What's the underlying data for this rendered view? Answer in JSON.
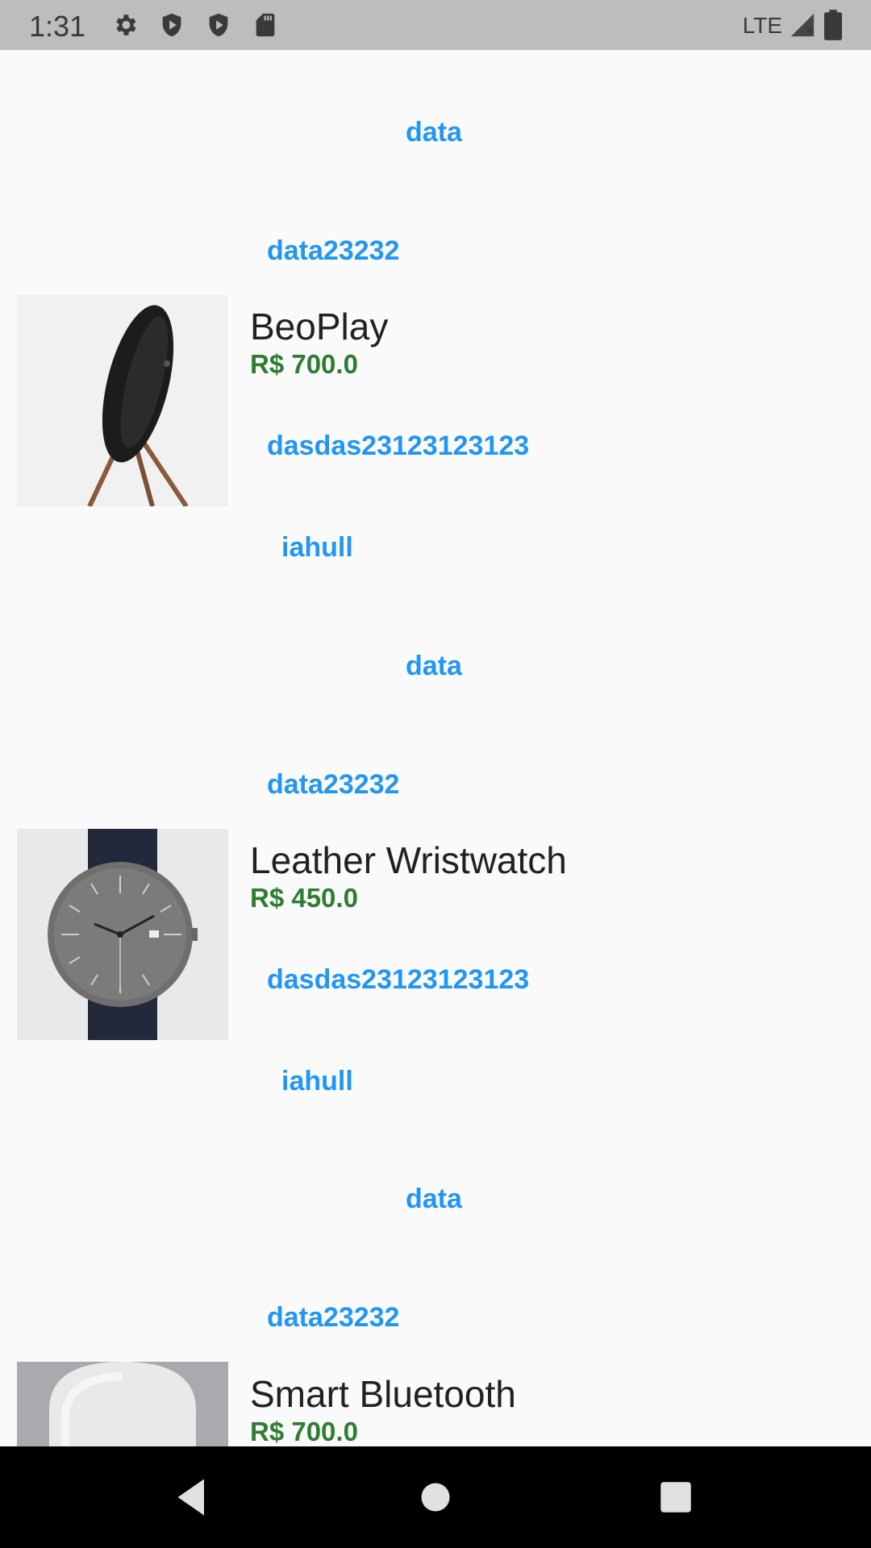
{
  "status_bar": {
    "time": "1:31",
    "network": "LTE",
    "icons": [
      "settings-icon",
      "shield-icon",
      "play-shield-icon",
      "sd-card-icon",
      "signal-icon",
      "battery-icon"
    ]
  },
  "products": [
    {
      "links_above": [
        "data",
        "data23232"
      ],
      "name": "BeoPlay",
      "price": "R$ 700.0",
      "links_below": [
        "dasdas23123123123",
        "iahull"
      ],
      "image": "speaker-on-tripod"
    },
    {
      "links_above": [
        "data",
        "data23232"
      ],
      "name": "Leather Wristwatch",
      "price": "R$ 450.0",
      "links_below": [
        "dasdas23123123123",
        "iahull"
      ],
      "image": "grey-wristwatch"
    },
    {
      "links_above": [
        "data",
        "data23232"
      ],
      "name": "Smart Bluetooth",
      "price": "R$ 700.0",
      "links_below": [],
      "image": "white-smart-speaker"
    }
  ],
  "colors": {
    "link": "#2196f3",
    "price": "#2e7d32",
    "status_bar": "#bdbdbd",
    "nav_bar": "#000000"
  },
  "nav_bar": {
    "icons": [
      "back-icon",
      "home-icon",
      "recents-icon"
    ]
  }
}
